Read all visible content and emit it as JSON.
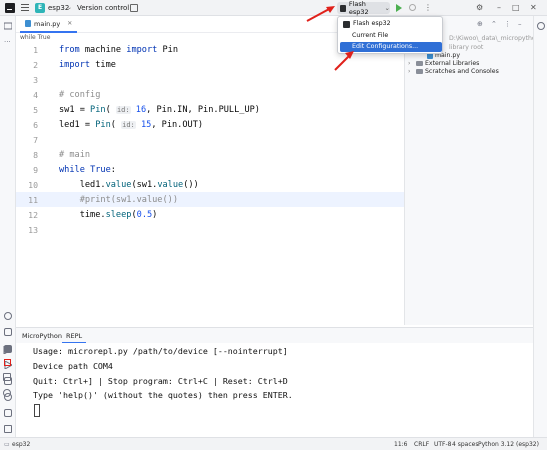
{
  "titlebar": {
    "project_badge": "E",
    "project_name": "esp32",
    "vcs_label": "Version control",
    "run_config_label": "Flash esp32"
  },
  "run_dropdown": {
    "items": [
      "Flash esp32",
      "Current File",
      "Edit Configurations..."
    ],
    "selected_index": 2
  },
  "editor": {
    "tab_label": "main.py",
    "breadcrumb": "while True",
    "current_line": 11,
    "line_numbers": [
      "1",
      "2",
      "3",
      "4",
      "5",
      "6",
      "7",
      "8",
      "9",
      "10",
      "11",
      "12",
      "13"
    ],
    "lines": [
      "from machine import Pin",
      "import time",
      "",
      "# config",
      "sw1 = Pin( id: 16, Pin.IN, Pin.PULL_UP)",
      "led1 = Pin( id: 15, Pin.OUT)",
      "",
      "# main",
      "while True:",
      "    led1.value(sw1.value())",
      "    #print(sw1.value())",
      "    time.sleep(0.5)",
      ""
    ],
    "inlay_hint": "id:"
  },
  "project_panel": {
    "hidden_path": "D:\\Kiwoo\\_data\\_micropytho",
    "hidden_root": "library root",
    "items": [
      "main.py",
      "External Libraries",
      "Scratches and Consoles"
    ]
  },
  "terminal": {
    "tabs": [
      "MicroPython",
      "REPL"
    ],
    "active_tab": "REPL",
    "lines": [
      "Usage: microrepl.py /path/to/device [--nointerrupt]",
      "Device path COM4",
      "Quit: Ctrl+] | Stop program: Ctrl+C | Reset: Ctrl+D",
      "Type 'help()' (without the quotes) then press ENTER."
    ]
  },
  "statusbar": {
    "project": "esp32",
    "position": "11:6",
    "line_sep": "CRLF",
    "encoding": "UTF-8",
    "indent": "4 spaces",
    "interpreter": "Python 3.12 (esp32)"
  },
  "colors": {
    "accent": "#3574f0",
    "selection": "#2f6fd6",
    "keyword": "#0033b3",
    "comment": "#8c8c8c",
    "number": "#1750eb",
    "annotation_arrow": "#e0211b"
  }
}
